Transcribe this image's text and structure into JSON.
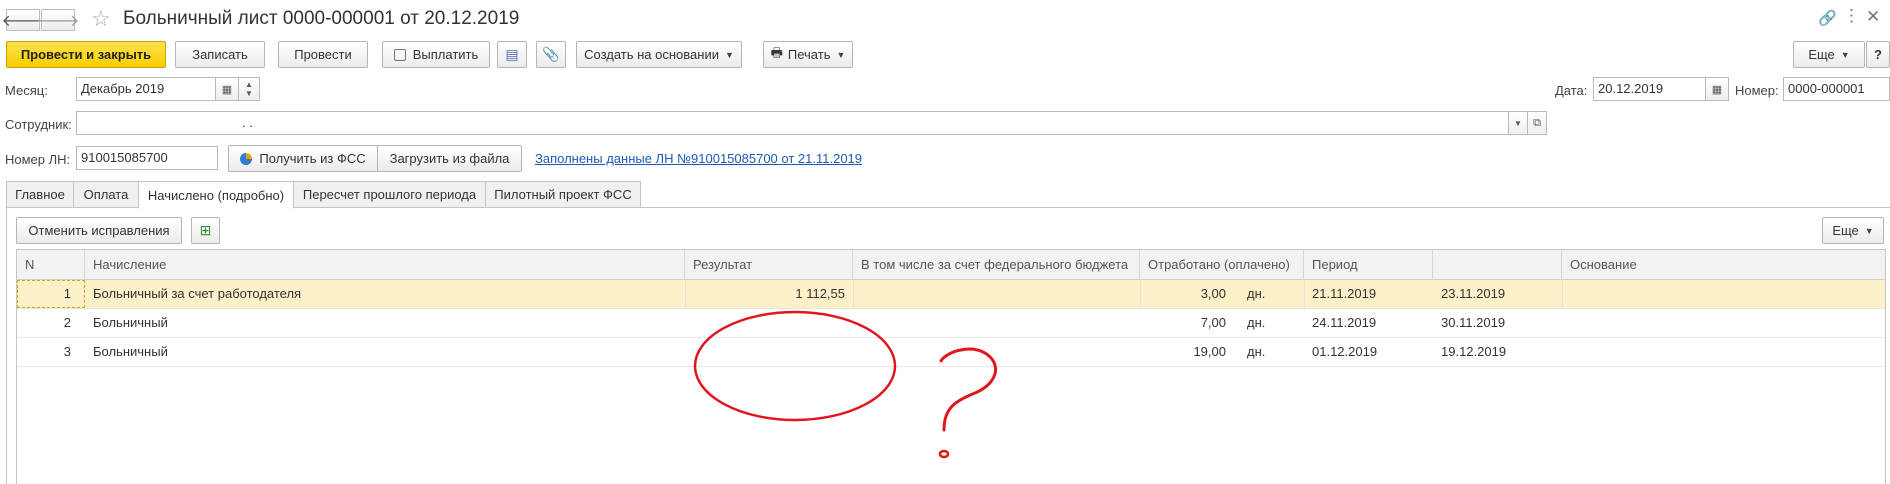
{
  "window": {
    "title": "Больничный лист 0000-000001 от 20.12.2019"
  },
  "toolbar": {
    "post_close": "Провести и закрыть",
    "save": "Записать",
    "post": "Провести",
    "pay": "Выплатить",
    "create_based": "Создать на основании",
    "print": "Печать",
    "more": "Еще",
    "help": "?"
  },
  "form": {
    "month_label": "Месяц:",
    "month_value": "Декабрь 2019",
    "date_label": "Дата:",
    "date_value": "20.12.2019",
    "number_label": "Номер:",
    "number_value": "0000-000001",
    "employee_label": "Сотрудник:",
    "employee_value": ". .",
    "ln_label": "Номер ЛН:",
    "ln_value": "910015085700",
    "get_fss": "Получить из ФСС",
    "load_file": "Загрузить из файла",
    "filled_link": "Заполнены данные ЛН №910015085700 от 21.11.2019"
  },
  "tabs": [
    {
      "label": "Главное"
    },
    {
      "label": "Оплата"
    },
    {
      "label": "Начислено (подробно)"
    },
    {
      "label": "Пересчет прошлого периода"
    },
    {
      "label": "Пилотный проект ФСС"
    }
  ],
  "tab_toolbar": {
    "cancel_corrections": "Отменить исправления",
    "more": "Еще"
  },
  "table": {
    "columns": [
      "N",
      "Начисление",
      "Результат",
      "В том числе за счет федерального бюджета",
      "Отработано (оплачено)",
      "Период",
      "",
      "Основание"
    ],
    "rows": [
      {
        "n": "1",
        "accrual": "Больничный за счет работодателя",
        "result": "1 112,55",
        "federal": "",
        "worked": "3,00",
        "unit": "дн.",
        "from": "21.11.2019",
        "to": "23.11.2019",
        "basis": ""
      },
      {
        "n": "2",
        "accrual": "Больничный",
        "result": "",
        "federal": "",
        "worked": "7,00",
        "unit": "дн.",
        "from": "24.11.2019",
        "to": "30.11.2019",
        "basis": ""
      },
      {
        "n": "3",
        "accrual": "Больничный",
        "result": "",
        "federal": "",
        "worked": "19,00",
        "unit": "дн.",
        "from": "01.12.2019",
        "to": "19.12.2019",
        "basis": ""
      }
    ]
  },
  "colors": {
    "primary_button": "#f7cd00",
    "selected_row": "#fbf0c8",
    "link": "#1c5ab5",
    "annotation": "#e0161b"
  }
}
